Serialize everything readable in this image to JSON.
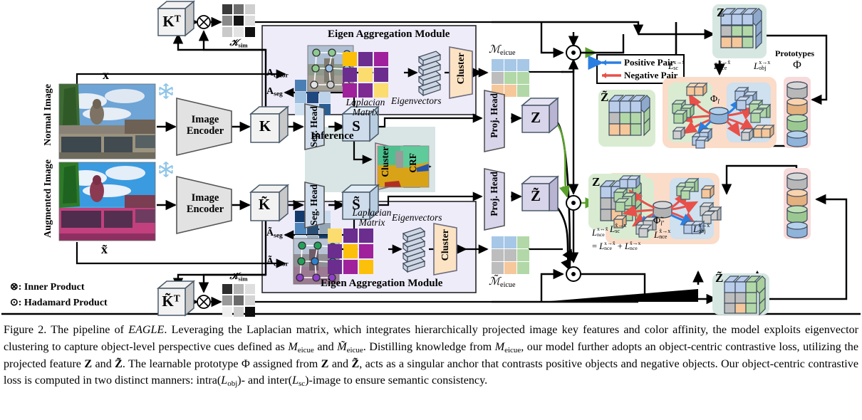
{
  "figure": {
    "number": "Figure 2.",
    "caption_parts": {
      "p1": "The pipeline of ",
      "name": "EAGLE",
      "p2": ". Leveraging the Laplacian matrix, which integrates hierarchically projected image key features and color affinity, the model exploits eigenvector clustering to capture object-level perspective cues defined as ",
      "m1": "M",
      "m1sub": "eicue",
      "p3": " and ",
      "m2": "M̃",
      "m2sub": "eicue",
      "p4": ". Distilling knowledge from ",
      "m3": "M",
      "m3sub": "eicue",
      "p5": ", our model further adopts an object-centric contrastive loss, utilizing the projected feature ",
      "z1": "Z",
      "p6": " and ",
      "z2": "Z̃",
      "p7": ". The learnable prototype Φ assigned from ",
      "z3": "Z",
      "p8": " and ",
      "z4": "Z̃",
      "p9": ", acts as a singular anchor that contrasts positive objects and negative objects. Our object-centric contrastive loss is computed in two distinct manners: intra(",
      "l1": "L",
      "l1sub": "obj",
      "p10": ")- and inter(",
      "l2": "L",
      "l2sub": "sc",
      "p11": ")-image to ensure semantic consistency."
    }
  },
  "branches": {
    "normal": {
      "row_label": "Normal Image",
      "input_label": "x",
      "encoder": "Image Encoder",
      "key": "K",
      "key_t": "K",
      "key_t_sup": "T",
      "seg_head": "Seg. Head",
      "seg_out": "S",
      "ksim": "𝒦",
      "ksim_sub": "sim",
      "a_color": "A",
      "a_color_sub": "color",
      "a_seg": "A",
      "a_seg_sub": "seg",
      "module_title": "Eigen Aggregation Module",
      "laplacian": "Laplacian Matrix",
      "eigenvectors": "Eigenvectors",
      "cluster": "Cluster",
      "eicue": "ℳ",
      "eicue_sub": "eicue",
      "proj_head": "Proj. Head",
      "z": "Z"
    },
    "augmented": {
      "row_label": "Augmented Image",
      "input_label": "x̃",
      "encoder": "Image Encoder",
      "key": "K̃",
      "key_t": "K̃",
      "key_t_sup": "T",
      "seg_head": "Seg. Head",
      "seg_out": "S̃",
      "ksim": "𝒦̃",
      "ksim_sub": "sim",
      "a_color": "Ã",
      "a_color_sub": "color",
      "a_seg": "Ã",
      "a_seg_sub": "seg",
      "module_title": "Eigen Aggregation Module",
      "laplacian": "Laplacian Matrix",
      "eigenvectors": "Eigenvectors",
      "cluster": "Cluster",
      "eicue": "ℳ̃",
      "eicue_sub": "eicue",
      "proj_head": "Proj. Head",
      "z": "Z̃"
    }
  },
  "inference": {
    "title": "Inference",
    "cluster": "Cluster",
    "crf": "CRF"
  },
  "legend_pairs": {
    "positive": "Positive Pair",
    "negative": "Negative Pair"
  },
  "symbol_legend": {
    "inner": ": Inner Product",
    "inner_glyph": "⊗",
    "hadamard": ": Hadamard Product",
    "hadamard_glyph": "⊙"
  },
  "contrastive": {
    "top": {
      "z_cube": "Z",
      "ztilde_cube": "Z̃",
      "loss_sc": "L",
      "loss_sc_sub": "sc",
      "loss_sc_sup": "x→x̃",
      "loss_nce": "L",
      "loss_nce_sub": "nce",
      "loss_nce_sup": "x→x̃",
      "loss_obj": "L",
      "loss_obj_sub": "obj",
      "loss_obj_sup": "x→x",
      "anchor": "Φ",
      "anchor_sub": "l"
    },
    "bottom": {
      "z_cube": "Z",
      "ztilde_cube": "Z̃",
      "loss_sc": "L",
      "loss_sc_sub": "sc",
      "loss_sc_sup": "x̃→x",
      "loss_nce": "L",
      "loss_nce_sub": "nce",
      "loss_nce_sup": "x̃→x",
      "loss_obj": "L",
      "loss_obj_sub": "obj",
      "loss_obj_sup": "x̃→x̃",
      "anchor": "Φ̃",
      "anchor_sub": "l′",
      "total_lhs": "L",
      "total_lhs_sub": "nce",
      "total_lhs_sup": "x↔x̃",
      "total_rhs": "= L nce x→x̃ + L nce x̃→x"
    },
    "prototypes_label": "Prototypes",
    "prototypes_symbol": "Φ"
  },
  "colors": {
    "module_bg": "#efecfa",
    "inference_bg": "#d9e5e4",
    "cube_face": "#d8d5ea",
    "cube_blue": "#cfdcec",
    "cluster_fill": "#fbe3c4",
    "crf_fill": "#ded9f0",
    "inf_cluster_fill": "#f6d0cf",
    "positive": "#2b7fe0",
    "negative": "#e8504a",
    "green_path": "#5aa02c",
    "panel_pink": "#fadcc9",
    "panel_green": "#d9ecd2",
    "panel_blue": "#cfe0ee",
    "proto_bg": "#f7dada",
    "cube_z_bg": "#d6e7e2",
    "cube_zt_bg": "#d9ecd2"
  }
}
